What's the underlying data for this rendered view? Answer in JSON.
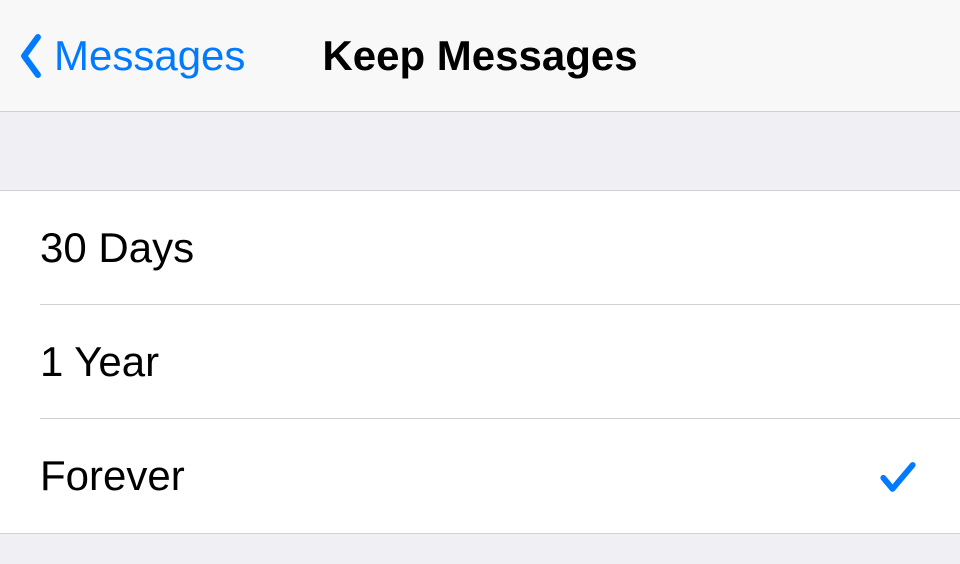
{
  "nav": {
    "back_label": "Messages",
    "title": "Keep Messages"
  },
  "options": [
    {
      "label": "30 Days",
      "selected": false
    },
    {
      "label": "1 Year",
      "selected": false
    },
    {
      "label": "Forever",
      "selected": true
    }
  ],
  "colors": {
    "tint": "#007aff",
    "group_bg": "#efeff4",
    "separator": "#d1d1d5"
  }
}
